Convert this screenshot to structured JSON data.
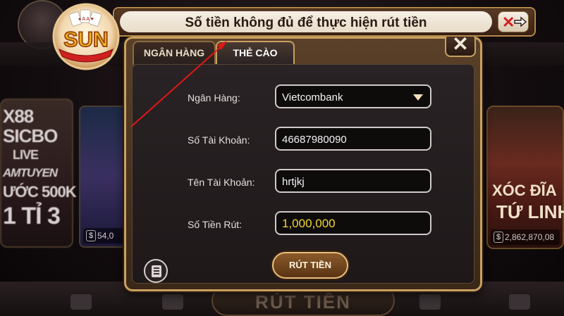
{
  "notification": {
    "message": "Số tiền không đủ để thực hiện rút tiền",
    "close_icon": "close-x-icon"
  },
  "logo": {
    "text": "SUN",
    "cards": "♠ A A ♥"
  },
  "background": {
    "left_card_lines": [
      "X88",
      "SICBO",
      "LIVE",
      "AMTUYEN",
      "ƯỚC 500K",
      "1 TỈ 3"
    ],
    "left_card_balance": "54,0",
    "right_card_lines": [
      "XÓC ĐĨA",
      "TỨ LINH"
    ],
    "right_card_balance": "2,862,870,08",
    "bottom_button": "RÚT TIỀN"
  },
  "dialog": {
    "tabs": [
      {
        "label": "NGÂN HÀNG",
        "active": false
      },
      {
        "label": "THẺ CÀO",
        "active": true
      }
    ],
    "close_label": "✕",
    "form": {
      "bank_label": "Ngân Hàng:",
      "bank_value": "Vietcombank",
      "account_number_label": "Số Tài Khoản:",
      "account_number_value": "46687980090",
      "account_name_label": "Tên Tài Khoản:",
      "account_name_value": "hrtjkj",
      "amount_label": "Số Tiền Rút:",
      "amount_value": "1,000,000"
    },
    "submit_label": "RÚT TIỀN",
    "history_icon": "document-history-icon"
  },
  "colors": {
    "gold_border": "#c8a060",
    "amount_text": "#f0d634",
    "error_text": "#2a1a12",
    "annotation_arrow": "#e01818"
  }
}
